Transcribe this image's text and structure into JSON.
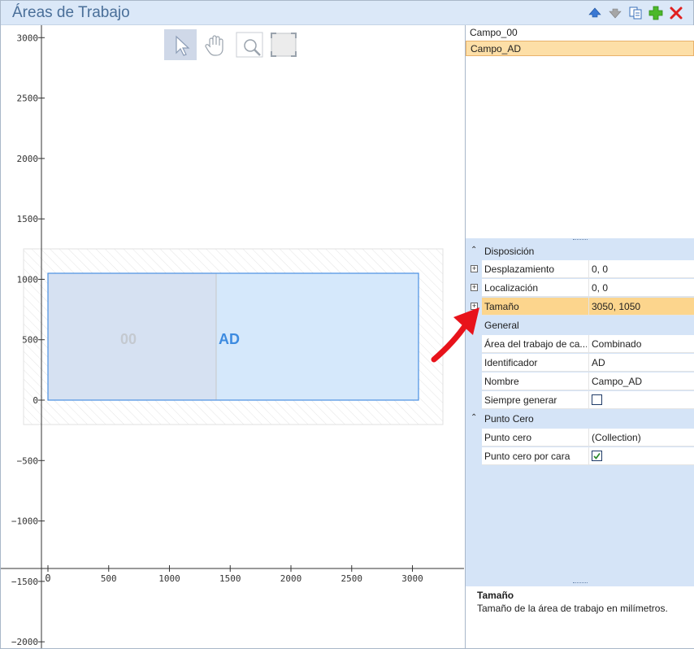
{
  "window": {
    "title": "Áreas de Trabajo"
  },
  "toolbar": {
    "buttons": [
      {
        "name": "move-up",
        "icon": "arrow-up-icon",
        "color": "#3a78d3"
      },
      {
        "name": "move-down",
        "icon": "arrow-down-icon",
        "color": "#9a9a9a"
      },
      {
        "name": "copy",
        "icon": "copy-icon",
        "color": "#3a6fb8"
      },
      {
        "name": "add",
        "icon": "plus-icon",
        "color": "#3aa81a"
      },
      {
        "name": "delete",
        "icon": "close-icon",
        "color": "#e02020"
      }
    ]
  },
  "canvas": {
    "tools": [
      {
        "name": "select",
        "icon": "cursor-icon",
        "active": true
      },
      {
        "name": "pan",
        "icon": "hand-icon",
        "active": false
      },
      {
        "name": "zoom",
        "icon": "zoom-icon",
        "active": false
      },
      {
        "name": "fit",
        "icon": "fit-icon",
        "active": false
      }
    ],
    "y_ticks": [
      "3000",
      "2500",
      "2000",
      "1500",
      "1000",
      "500",
      "0",
      "−1000",
      "−500",
      "−1500",
      "−2000"
    ],
    "x_ticks": [
      "0",
      "500",
      "1000",
      "1500",
      "2000",
      "2500",
      "3000"
    ],
    "area_left_label": "00",
    "area_right_label": "AD",
    "colors": {
      "area_fill": "#d5e8fb",
      "area_border": "#4a90e2",
      "left_fill": "#d6e1f2",
      "label_blue": "#3d8be0",
      "label_gray": "#c4c9d0"
    }
  },
  "work_areas": [
    "Campo_00",
    "Campo_AD"
  ],
  "selected_area": "Campo_AD",
  "properties": {
    "disposicion": {
      "title": "Disposición",
      "rows": [
        {
          "name": "Desplazamiento",
          "value": "0, 0"
        },
        {
          "name": "Localización",
          "value": "0, 0"
        },
        {
          "name": "Tamaño",
          "value": "3050, 1050"
        }
      ]
    },
    "general": {
      "title": "General",
      "rows": [
        {
          "name": "Área del trabajo de ca...",
          "value": "Combinado"
        },
        {
          "name": "Identificador",
          "value": "AD"
        },
        {
          "name": "Nombre",
          "value": "Campo_AD"
        },
        {
          "name": "Siempre generar",
          "value": "",
          "checked": false
        }
      ]
    },
    "punto_cero": {
      "title": "Punto Cero",
      "rows": [
        {
          "name": "Punto cero",
          "value": "(Collection)"
        },
        {
          "name": "Punto cero por cara",
          "value": "",
          "checked": true
        }
      ]
    }
  },
  "description": {
    "title": "Tamaño",
    "text": "Tamaño de la área de trabajo en milímetros."
  },
  "annotation": {
    "color": "#e8131b",
    "icon": "red-arrow-icon"
  }
}
